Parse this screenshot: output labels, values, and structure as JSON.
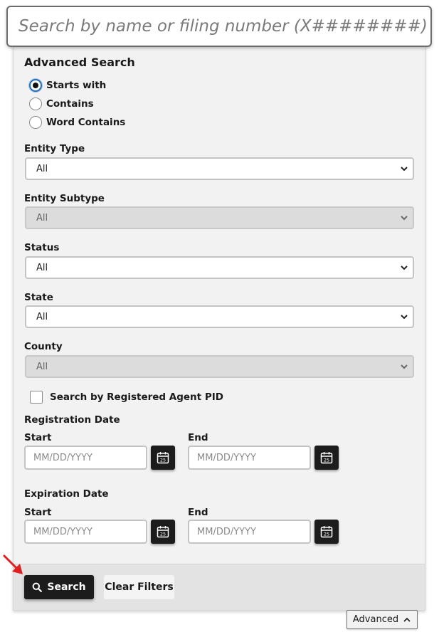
{
  "search": {
    "placeholder": "Search by name or filing number (X########)"
  },
  "advanced": {
    "title": "Advanced Search",
    "match_options": [
      {
        "label": "Starts with",
        "checked": true
      },
      {
        "label": "Contains",
        "checked": false
      },
      {
        "label": "Word Contains",
        "checked": false
      }
    ],
    "fields": {
      "entity_type": {
        "label": "Entity Type",
        "value": "All"
      },
      "entity_subtype": {
        "label": "Entity Subtype",
        "value": "All"
      },
      "status": {
        "label": "Status",
        "value": "All"
      },
      "state": {
        "label": "State",
        "value": "All"
      },
      "county": {
        "label": "County",
        "value": "All"
      }
    },
    "agent_checkbox": "Search by Registered Agent PID",
    "registration": {
      "label": "Registration Date",
      "start_label": "Start",
      "end_label": "End",
      "start_placeholder": "MM/DD/YYYY",
      "end_placeholder": "MM/DD/YYYY"
    },
    "expiration": {
      "label": "Expiration Date",
      "start_label": "Start",
      "end_label": "End",
      "start_placeholder": "MM/DD/YYYY",
      "end_placeholder": "MM/DD/YYYY"
    },
    "calendar_day": "25",
    "search_button": "Search",
    "clear_button": "Clear Filters"
  },
  "toggle": {
    "label": "Advanced"
  },
  "colors": {
    "accent": "#1c1c1c",
    "radio_focus": "#2a6fb8",
    "annotation_arrow": "#e02020"
  }
}
